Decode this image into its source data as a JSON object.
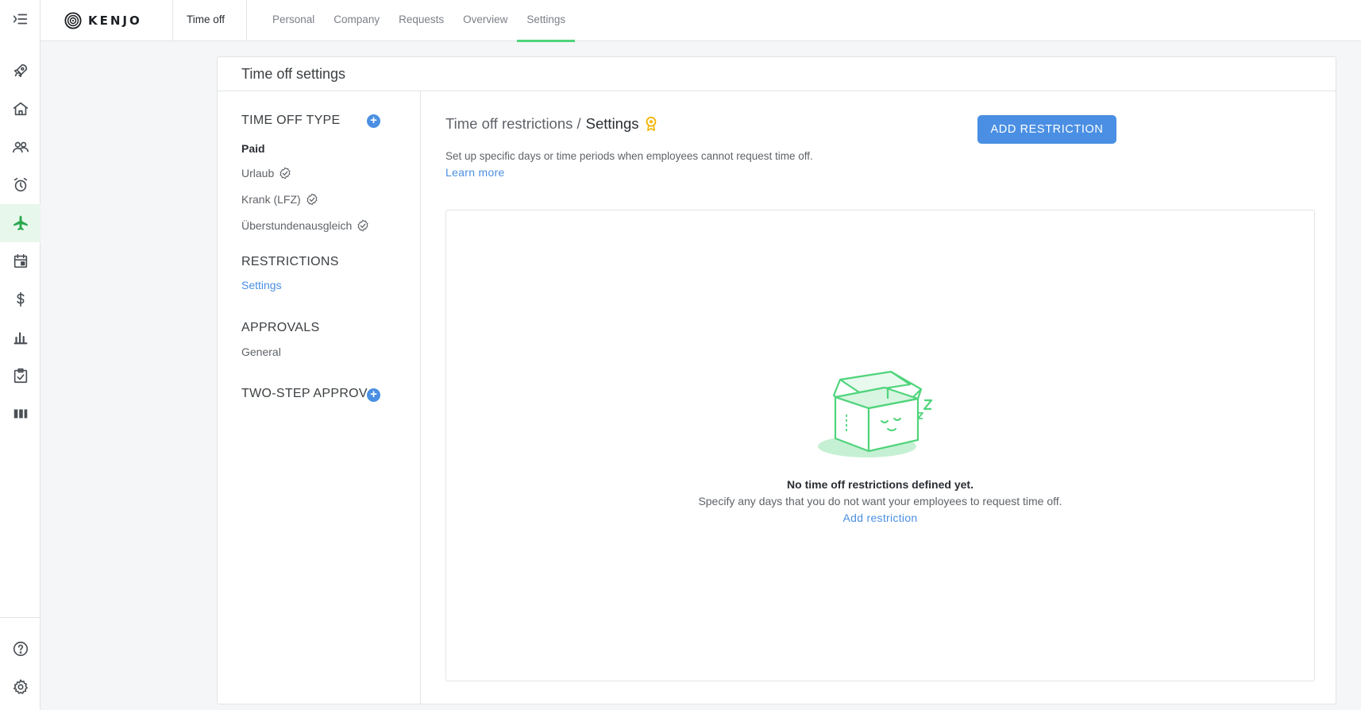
{
  "rail": {
    "items": [
      {
        "icon": "menu-collapse-icon"
      },
      {
        "icon": "rocket-icon"
      },
      {
        "icon": "home-icon"
      },
      {
        "icon": "people-icon"
      },
      {
        "icon": "alarm-clock-icon"
      },
      {
        "icon": "airplane-icon",
        "active": true
      },
      {
        "icon": "calendar-icon"
      },
      {
        "icon": "dollar-icon"
      },
      {
        "icon": "bar-chart-icon"
      },
      {
        "icon": "checklist-icon"
      },
      {
        "icon": "columns-icon"
      },
      {
        "icon": "help-icon"
      },
      {
        "icon": "gear-icon"
      }
    ]
  },
  "topbar": {
    "logo_text": "KENJO",
    "module": "Time off",
    "tabs": [
      "Personal",
      "Company",
      "Requests",
      "Overview",
      "Settings"
    ],
    "active_tab": "Settings"
  },
  "page": {
    "title": "Time off settings"
  },
  "sidebar": {
    "time_off_type": {
      "heading": "TIME OFF TYPE",
      "items": [
        {
          "label": "Paid",
          "bold": true
        },
        {
          "label": "Urlaub",
          "verified": true
        },
        {
          "label": "Krank (LFZ)",
          "verified": true
        },
        {
          "label": "Überstundenausgleich",
          "verified": true
        }
      ]
    },
    "restrictions": {
      "heading": "RESTRICTIONS",
      "items": [
        {
          "label": "Settings",
          "active": true
        }
      ]
    },
    "approvals": {
      "heading": "APPROVALS",
      "items": [
        {
          "label": "General"
        }
      ]
    },
    "two_step": {
      "heading": "TWO-STEP APPROV..."
    }
  },
  "content": {
    "breadcrumb_parent": "Time off restrictions /",
    "breadcrumb_current": "Settings",
    "description": "Set up specific days or time periods when employees cannot request time off.",
    "learn_more": "Learn more",
    "add_button": "ADD RESTRICTION",
    "empty": {
      "title": "No time off restrictions defined yet.",
      "description": "Specify any days that you do not want your employees to request time off.",
      "link": "Add restriction"
    }
  },
  "colors": {
    "accent": "#4a8fe3",
    "active_green": "#4fd47b",
    "badge": "#f5b400"
  }
}
